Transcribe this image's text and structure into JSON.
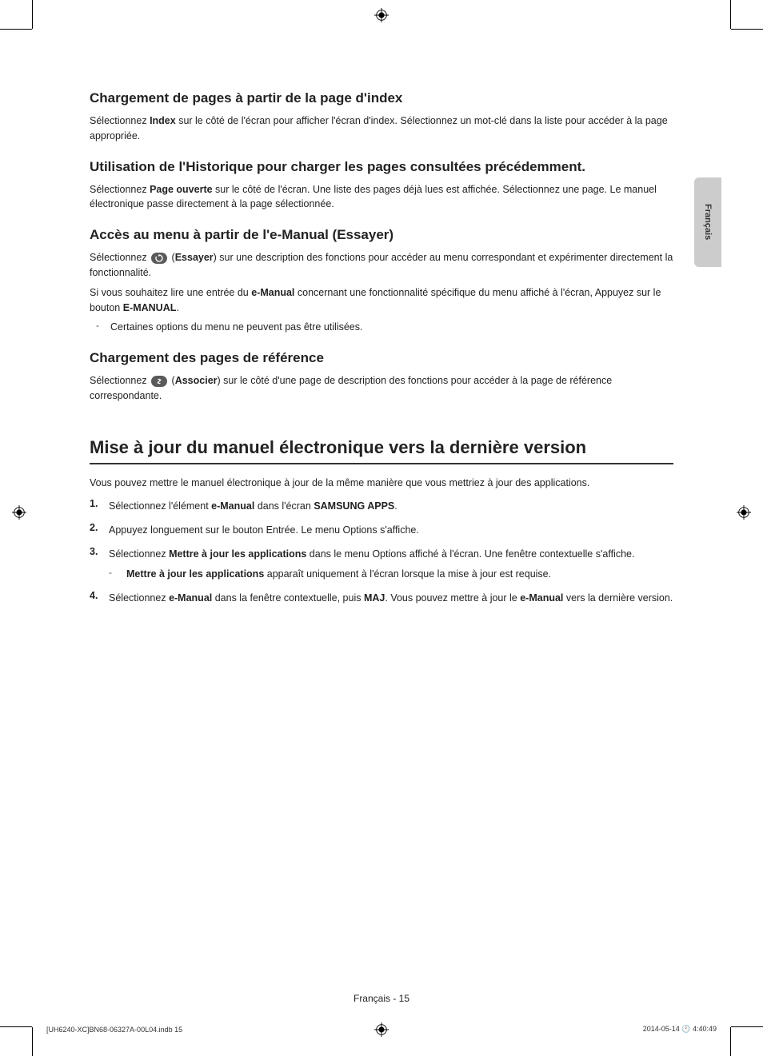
{
  "side_tab": "Français",
  "sections": {
    "s1": {
      "heading": "Chargement de pages à partir de la page d'index",
      "p1_a": "Sélectionnez ",
      "p1_b": "Index",
      "p1_c": " sur le côté de l'écran pour afficher l'écran d'index. Sélectionnez un mot-clé dans la liste pour accéder à la page appropriée."
    },
    "s2": {
      "heading": "Utilisation de l'Historique pour charger les pages consultées précédemment.",
      "p1_a": "Sélectionnez ",
      "p1_b": "Page ouverte",
      "p1_c": " sur le côté de l'écran. Une liste des pages déjà lues est affichée. Sélectionnez une page. Le manuel électronique passe directement à la page sélectionnée."
    },
    "s3": {
      "heading": "Accès au menu à partir de l'e-Manual (Essayer)",
      "p1_a": "Sélectionnez ",
      "p1_b": "Essayer",
      "p1_c": ") sur une description des fonctions pour accéder au menu correspondant et expérimenter directement la fonctionnalité.",
      "p2_a": "Si vous souhaitez lire une entrée du ",
      "p2_b": "e-Manual",
      "p2_c": " concernant une fonctionnalité spécifique du menu affiché à l'écran, Appuyez sur le bouton ",
      "p2_d": "E-MANUAL",
      "p2_e": ".",
      "bullet1": "Certaines options du menu ne peuvent pas être utilisées."
    },
    "s4": {
      "heading": "Chargement des pages de référence",
      "p1_a": "Sélectionnez ",
      "p1_b": "Associer",
      "p1_c": ") sur le côté d'une page de description des fonctions pour accéder à la page de référence correspondante."
    },
    "main": {
      "heading": "Mise à jour du manuel électronique vers la dernière version",
      "intro": "Vous pouvez mettre le manuel électronique à jour de la même manière que vous mettriez à jour des applications.",
      "li1_a": "Sélectionnez l'élément ",
      "li1_b": "e-Manual",
      "li1_c": " dans l'écran ",
      "li1_d": "SAMSUNG APPS",
      "li1_e": ".",
      "li2": "Appuyez longuement sur le bouton Entrée. Le menu Options s'affiche.",
      "li3_a": "Sélectionnez ",
      "li3_b": "Mettre à jour les applications",
      "li3_c": " dans le menu Options affiché à l'écran. Une fenêtre contextuelle s'affiche.",
      "li3_sub_a": "Mettre à jour les applications",
      "li3_sub_b": " apparaît uniquement à l'écran lorsque la mise à jour est requise.",
      "li4_a": "Sélectionnez ",
      "li4_b": "e-Manual",
      "li4_c": " dans la fenêtre contextuelle, puis ",
      "li4_d": "MAJ",
      "li4_e": ". Vous pouvez mettre à jour le ",
      "li4_f": "e-Manual",
      "li4_g": " vers la dernière version."
    }
  },
  "footer": {
    "center": "Français - 15",
    "left": "[UH6240-XC]BN68-06327A-00L04.indb   15",
    "right_date": "2014-05-14   ",
    "right_time": "4:40:49"
  },
  "numbers": {
    "n1": "1.",
    "n2": "2.",
    "n3": "3.",
    "n4": "4."
  }
}
